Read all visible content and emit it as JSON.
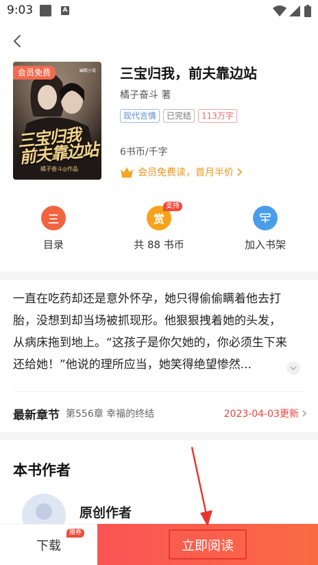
{
  "status": {
    "time": "9:03",
    "notif_letter": "A"
  },
  "book": {
    "title": "三宝归我，前夫靠边站",
    "author": "橘子奋斗 著",
    "tags": [
      "现代言情",
      "已完结",
      "113万字"
    ],
    "price": "6书币/千字",
    "vip_text": "会员免费读，首月半价",
    "cover_badge": "会员免费",
    "cover_title": "三宝归我 前夫靠边站",
    "cover_sub": "橘子奋斗◎作品",
    "cover_brand": "幽默小说"
  },
  "actions": {
    "toc_icon": "三",
    "toc_label": "目录",
    "reward_icon": "赏",
    "reward_badge": "支持",
    "reward_label": "共 88 书币",
    "shelf_label": "加入书架"
  },
  "description": "一直在吃药却还是意外怀孕，她只得偷偷瞒着他去打胎，没想到却当场被抓现形。他狠狠拽着她的头发，从病床拖到地上。“这孩子是你欠她的，你必须生下来还给她！”他说的理所应当，她笑得绝望惨然...",
  "latest": {
    "label": "最新章节",
    "chapter": "第556章 幸福的终结",
    "date": "2023-04-03更新"
  },
  "author_section": {
    "heading": "本书作者",
    "name": "原创作者"
  },
  "bottom": {
    "download_label": "下载",
    "coupon_badge": "赠券",
    "read_label": "立即阅读"
  },
  "colors": {
    "accent_red": "#f04b3c",
    "vip_orange": "#f0941e",
    "read_gradient_start": "#fa5454",
    "read_gradient_end": "#fb6a44"
  },
  "icons": {
    "back": "chevron-left-icon",
    "toc": "list-icon",
    "reward": "reward-icon",
    "shelf": "bookshelf-icon",
    "vip": "crown-icon",
    "expand": "chevron-down-icon",
    "latest_arrow": "chevron-right-icon"
  }
}
